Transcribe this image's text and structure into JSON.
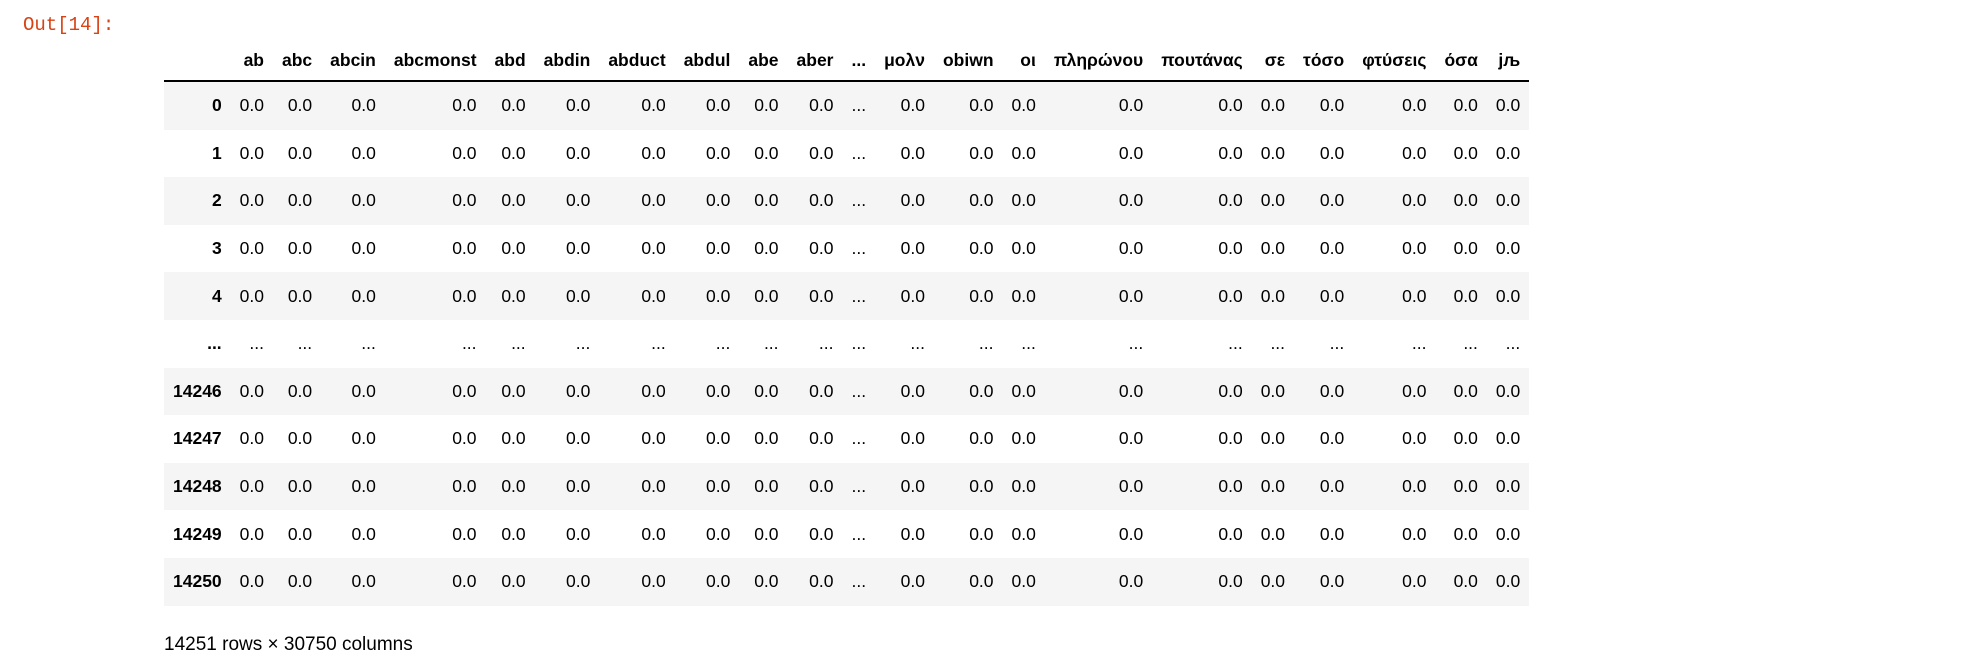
{
  "prompt": "Out[14]:",
  "table": {
    "columns": [
      "ab",
      "abc",
      "abcin",
      "abcmonst",
      "abd",
      "abdin",
      "abduct",
      "abdul",
      "abe",
      "aber",
      "...",
      "μολν",
      "obiwn",
      "οι",
      "πληρώνου",
      "πουτάνας",
      "σε",
      "τόσο",
      "φτύσεις",
      "όσα",
      "jљ"
    ],
    "rows": [
      {
        "index": "0",
        "values": [
          "0.0",
          "0.0",
          "0.0",
          "0.0",
          "0.0",
          "0.0",
          "0.0",
          "0.0",
          "0.0",
          "0.0",
          "...",
          "0.0",
          "0.0",
          "0.0",
          "0.0",
          "0.0",
          "0.0",
          "0.0",
          "0.0",
          "0.0",
          "0.0"
        ]
      },
      {
        "index": "1",
        "values": [
          "0.0",
          "0.0",
          "0.0",
          "0.0",
          "0.0",
          "0.0",
          "0.0",
          "0.0",
          "0.0",
          "0.0",
          "...",
          "0.0",
          "0.0",
          "0.0",
          "0.0",
          "0.0",
          "0.0",
          "0.0",
          "0.0",
          "0.0",
          "0.0"
        ]
      },
      {
        "index": "2",
        "values": [
          "0.0",
          "0.0",
          "0.0",
          "0.0",
          "0.0",
          "0.0",
          "0.0",
          "0.0",
          "0.0",
          "0.0",
          "...",
          "0.0",
          "0.0",
          "0.0",
          "0.0",
          "0.0",
          "0.0",
          "0.0",
          "0.0",
          "0.0",
          "0.0"
        ]
      },
      {
        "index": "3",
        "values": [
          "0.0",
          "0.0",
          "0.0",
          "0.0",
          "0.0",
          "0.0",
          "0.0",
          "0.0",
          "0.0",
          "0.0",
          "...",
          "0.0",
          "0.0",
          "0.0",
          "0.0",
          "0.0",
          "0.0",
          "0.0",
          "0.0",
          "0.0",
          "0.0"
        ]
      },
      {
        "index": "4",
        "values": [
          "0.0",
          "0.0",
          "0.0",
          "0.0",
          "0.0",
          "0.0",
          "0.0",
          "0.0",
          "0.0",
          "0.0",
          "...",
          "0.0",
          "0.0",
          "0.0",
          "0.0",
          "0.0",
          "0.0",
          "0.0",
          "0.0",
          "0.0",
          "0.0"
        ]
      },
      {
        "index": "...",
        "values": [
          "...",
          "...",
          "...",
          "...",
          "...",
          "...",
          "...",
          "...",
          "...",
          "...",
          "...",
          "...",
          "...",
          "...",
          "...",
          "...",
          "...",
          "...",
          "...",
          "...",
          "..."
        ]
      },
      {
        "index": "14246",
        "values": [
          "0.0",
          "0.0",
          "0.0",
          "0.0",
          "0.0",
          "0.0",
          "0.0",
          "0.0",
          "0.0",
          "0.0",
          "...",
          "0.0",
          "0.0",
          "0.0",
          "0.0",
          "0.0",
          "0.0",
          "0.0",
          "0.0",
          "0.0",
          "0.0"
        ]
      },
      {
        "index": "14247",
        "values": [
          "0.0",
          "0.0",
          "0.0",
          "0.0",
          "0.0",
          "0.0",
          "0.0",
          "0.0",
          "0.0",
          "0.0",
          "...",
          "0.0",
          "0.0",
          "0.0",
          "0.0",
          "0.0",
          "0.0",
          "0.0",
          "0.0",
          "0.0",
          "0.0"
        ]
      },
      {
        "index": "14248",
        "values": [
          "0.0",
          "0.0",
          "0.0",
          "0.0",
          "0.0",
          "0.0",
          "0.0",
          "0.0",
          "0.0",
          "0.0",
          "...",
          "0.0",
          "0.0",
          "0.0",
          "0.0",
          "0.0",
          "0.0",
          "0.0",
          "0.0",
          "0.0",
          "0.0"
        ]
      },
      {
        "index": "14249",
        "values": [
          "0.0",
          "0.0",
          "0.0",
          "0.0",
          "0.0",
          "0.0",
          "0.0",
          "0.0",
          "0.0",
          "0.0",
          "...",
          "0.0",
          "0.0",
          "0.0",
          "0.0",
          "0.0",
          "0.0",
          "0.0",
          "0.0",
          "0.0",
          "0.0"
        ]
      },
      {
        "index": "14250",
        "values": [
          "0.0",
          "0.0",
          "0.0",
          "0.0",
          "0.0",
          "0.0",
          "0.0",
          "0.0",
          "0.0",
          "0.0",
          "...",
          "0.0",
          "0.0",
          "0.0",
          "0.0",
          "0.0",
          "0.0",
          "0.0",
          "0.0",
          "0.0",
          "0.0"
        ]
      }
    ]
  },
  "footer": "14251 rows × 30750 columns",
  "colors": {
    "prompt": "#d84315",
    "stripe": "#f5f5f5"
  }
}
